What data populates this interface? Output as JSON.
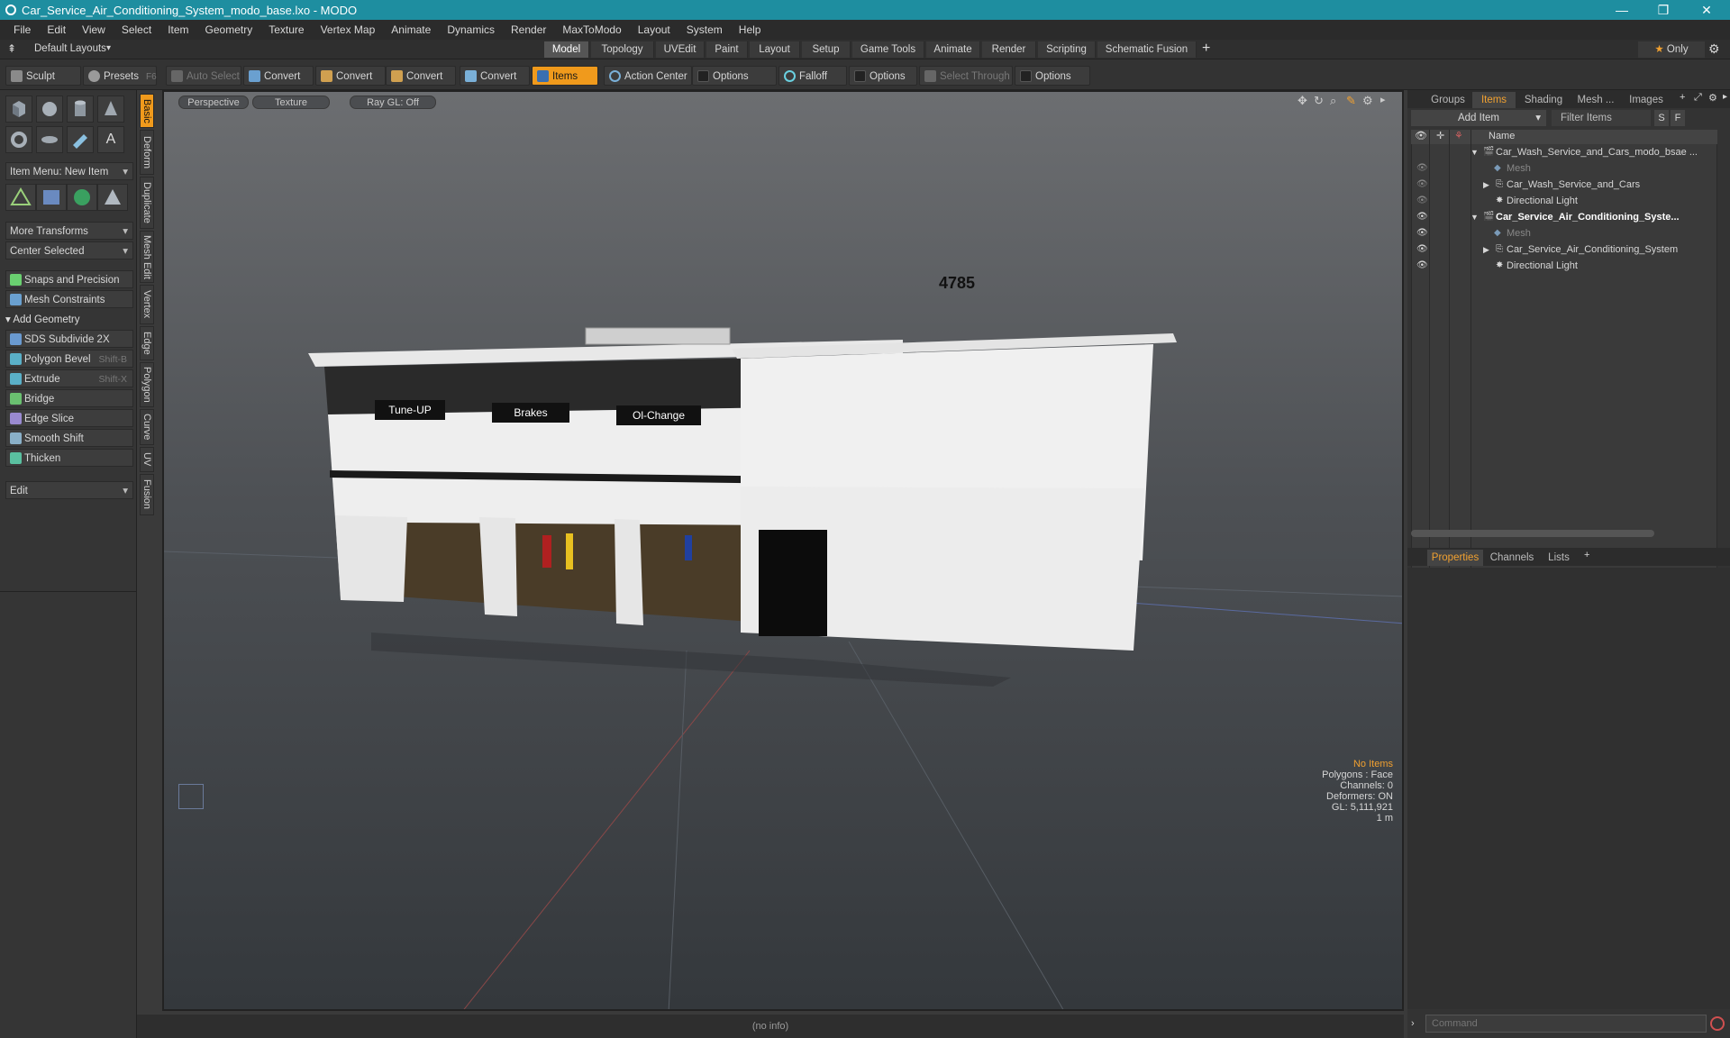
{
  "window": {
    "title": "Car_Service_Air_Conditioning_System_modo_base.lxo - MODO"
  },
  "menu": [
    "File",
    "Edit",
    "View",
    "Select",
    "Item",
    "Geometry",
    "Texture",
    "Vertex Map",
    "Animate",
    "Dynamics",
    "Render",
    "MaxToModo",
    "Layout",
    "System",
    "Help"
  ],
  "layouts": {
    "default_label": "Default Layouts",
    "tabs": [
      "Model",
      "Topology",
      "UVEdit",
      "Paint",
      "Layout",
      "Setup",
      "Game Tools",
      "Animate",
      "Render",
      "Scripting",
      "Schematic Fusion"
    ],
    "active": "Model",
    "only_label": "Only"
  },
  "toolbar": {
    "sculpt": "Sculpt",
    "presets": "Presets",
    "presets_key": "F6",
    "auto_select": "Auto Select",
    "convert": "Convert",
    "items": "Items",
    "action_center": "Action Center",
    "options": "Options",
    "falloff": "Falloff",
    "select_through": "Select Through"
  },
  "left": {
    "item_menu": "Item Menu: New Item",
    "more_transforms": "More Transforms",
    "center_selected": "Center Selected",
    "snaps": "Snaps and Precision",
    "mesh_constraints": "Mesh Constraints",
    "add_geometry": "Add Geometry",
    "tools": [
      {
        "label": "SDS Subdivide 2X",
        "shortcut": ""
      },
      {
        "label": "Polygon Bevel",
        "shortcut": "Shift-B"
      },
      {
        "label": "Extrude",
        "shortcut": "Shift-X"
      },
      {
        "label": "Bridge",
        "shortcut": ""
      },
      {
        "label": "Edge Slice",
        "shortcut": ""
      },
      {
        "label": "Smooth Shift",
        "shortcut": ""
      },
      {
        "label": "Thicken",
        "shortcut": ""
      }
    ],
    "edit": "Edit",
    "vtabs": [
      "Basic",
      "Deform",
      "Duplicate",
      "Mesh Edit",
      "Vertex",
      "Edge",
      "Polygon",
      "Curve",
      "UV",
      "Fusion"
    ]
  },
  "viewport": {
    "perspective": "Perspective",
    "texture": "Texture",
    "raygl": "Ray GL: Off",
    "building": {
      "number": "4785",
      "signs": [
        "Tune-UP",
        "Brakes",
        "Ol-Change"
      ]
    },
    "stats": {
      "no_items": "No Items",
      "polygons": "Polygons : Face",
      "channels": "Channels: 0",
      "deformers": "Deformers: ON",
      "gl": "GL: 5,111,921",
      "scale": "1 m"
    }
  },
  "right": {
    "tabs": [
      "Groups",
      "Items",
      "Shading",
      "Mesh ...",
      "Images"
    ],
    "active_tab": "Items",
    "add_item": "Add Item",
    "filter_items": "Filter Items",
    "s": "S",
    "f": "F",
    "name_header": "Name",
    "tree": [
      {
        "label": "Car_Wash_Service_and_Cars_modo_bsae ...",
        "indent": 0,
        "bold": false,
        "dim": false
      },
      {
        "label": "Mesh",
        "indent": 1,
        "bold": false,
        "dim": true
      },
      {
        "label": "Car_Wash_Service_and_Cars",
        "indent": 1,
        "bold": false,
        "dim": false
      },
      {
        "label": "Directional Light",
        "indent": 1,
        "bold": false,
        "dim": false
      },
      {
        "label": "Car_Service_Air_Conditioning_Syste...",
        "indent": 0,
        "bold": true,
        "dim": false
      },
      {
        "label": "Mesh",
        "indent": 1,
        "bold": false,
        "dim": true
      },
      {
        "label": "Car_Service_Air_Conditioning_System",
        "indent": 1,
        "bold": false,
        "dim": false
      },
      {
        "label": "Directional Light",
        "indent": 1,
        "bold": false,
        "dim": false
      }
    ],
    "bottom_tabs": [
      "Properties",
      "Channels",
      "Lists"
    ],
    "bottom_active": "Properties",
    "command_placeholder": "Command"
  },
  "status": {
    "info": "(no info)"
  },
  "colors": {
    "accent": "#f09a1c",
    "titlebar": "#1e8ea0"
  }
}
